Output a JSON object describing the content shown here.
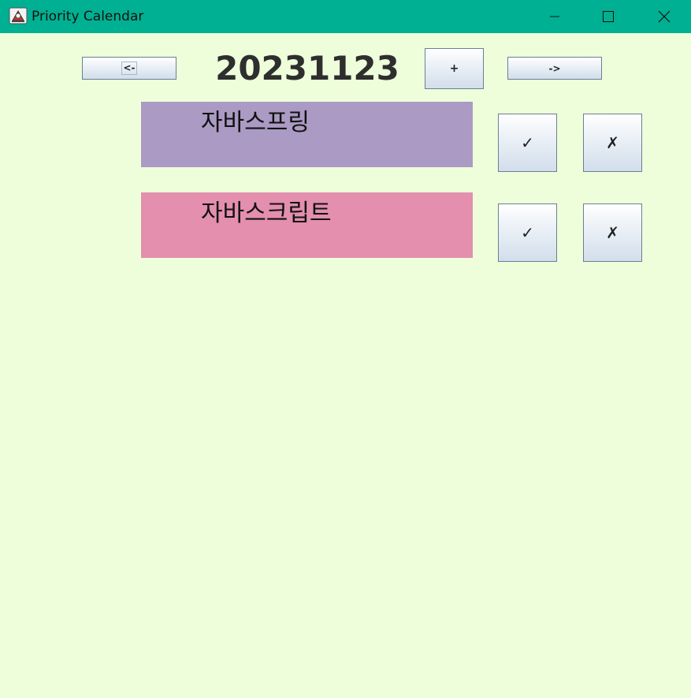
{
  "window": {
    "title": "Priority Calendar"
  },
  "colors": {
    "titlebar": "#00b092",
    "background": "#eefedb"
  },
  "header": {
    "prev_label": "<-",
    "date": "20231123",
    "add_label": "+",
    "next_label": "->"
  },
  "tasks": [
    {
      "text": "자바스프링",
      "color": "#ab9ac3",
      "done_label": "✓",
      "delete_label": "✗"
    },
    {
      "text": "자바스크립트",
      "color": "#e38fad",
      "done_label": "✓",
      "delete_label": "✗"
    }
  ]
}
